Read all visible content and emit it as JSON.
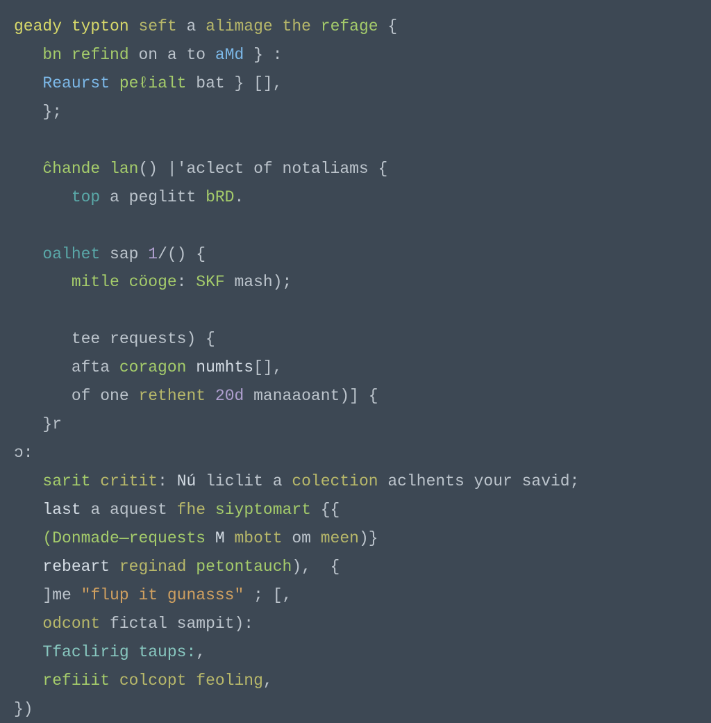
{
  "code": {
    "lines": [
      {
        "indent": 0,
        "tokens": [
          {
            "c": "t-yellow",
            "t": "geady typton"
          },
          {
            "c": "t-gray",
            "t": " "
          },
          {
            "c": "t-olive",
            "t": "seft"
          },
          {
            "c": "t-gray",
            "t": " a "
          },
          {
            "c": "t-olive",
            "t": "alimage"
          },
          {
            "c": "t-gray",
            "t": " "
          },
          {
            "c": "t-olive",
            "t": "the"
          },
          {
            "c": "t-gray",
            "t": " "
          },
          {
            "c": "t-green",
            "t": "refage"
          },
          {
            "c": "t-gray",
            "t": " {"
          }
        ]
      },
      {
        "indent": 1,
        "tokens": [
          {
            "c": "t-green",
            "t": "bn"
          },
          {
            "c": "t-gray",
            "t": " "
          },
          {
            "c": "t-green",
            "t": "refind"
          },
          {
            "c": "t-gray",
            "t": " on a to "
          },
          {
            "c": "t-blue",
            "t": "aMd"
          },
          {
            "c": "t-gray",
            "t": " } :"
          }
        ]
      },
      {
        "indent": 1,
        "tokens": [
          {
            "c": "t-blue",
            "t": "Reaurst"
          },
          {
            "c": "t-gray",
            "t": " "
          },
          {
            "c": "t-green",
            "t": "peℓialt"
          },
          {
            "c": "t-gray",
            "t": " bat } [],"
          }
        ]
      },
      {
        "indent": 1,
        "tokens": [
          {
            "c": "t-gray",
            "t": "};"
          }
        ]
      },
      {
        "indent": 0,
        "tokens": [
          {
            "c": "t-gray",
            "t": " "
          }
        ]
      },
      {
        "indent": 1,
        "tokens": [
          {
            "c": "t-green",
            "t": "ĉhande"
          },
          {
            "c": "t-gray",
            "t": " "
          },
          {
            "c": "t-green",
            "t": "lan"
          },
          {
            "c": "t-gray",
            "t": "() |'aclect of notaliams {"
          }
        ]
      },
      {
        "indent": 2,
        "tokens": [
          {
            "c": "t-teal",
            "t": "top"
          },
          {
            "c": "t-gray",
            "t": " a peglitt "
          },
          {
            "c": "t-green",
            "t": "bRD"
          },
          {
            "c": "t-gray",
            "t": "."
          }
        ]
      },
      {
        "indent": 0,
        "tokens": [
          {
            "c": "t-gray",
            "t": " "
          }
        ]
      },
      {
        "indent": 1,
        "tokens": [
          {
            "c": "t-teal",
            "t": "oalhet"
          },
          {
            "c": "t-gray",
            "t": " sap "
          },
          {
            "c": "t-lav",
            "t": "1"
          },
          {
            "c": "t-gray",
            "t": "/() {"
          }
        ]
      },
      {
        "indent": 2,
        "tokens": [
          {
            "c": "t-green",
            "t": "mitle"
          },
          {
            "c": "t-gray",
            "t": " "
          },
          {
            "c": "t-green",
            "t": "cöoge"
          },
          {
            "c": "t-gray",
            "t": ": "
          },
          {
            "c": "t-green",
            "t": "SKF"
          },
          {
            "c": "t-gray",
            "t": " mash);"
          }
        ]
      },
      {
        "indent": 0,
        "tokens": [
          {
            "c": "t-gray",
            "t": " "
          }
        ]
      },
      {
        "indent": 2,
        "tokens": [
          {
            "c": "t-gray",
            "t": "tee requests) {"
          }
        ]
      },
      {
        "indent": 2,
        "tokens": [
          {
            "c": "t-gray",
            "t": "afta "
          },
          {
            "c": "t-green",
            "t": "coragon"
          },
          {
            "c": "t-gray",
            "t": " "
          },
          {
            "c": "t-light",
            "t": "numhts"
          },
          {
            "c": "t-gray",
            "t": "[],"
          }
        ]
      },
      {
        "indent": 2,
        "tokens": [
          {
            "c": "t-gray",
            "t": "of one "
          },
          {
            "c": "t-olive",
            "t": "rethent"
          },
          {
            "c": "t-gray",
            "t": " "
          },
          {
            "c": "t-lav",
            "t": "20d"
          },
          {
            "c": "t-gray",
            "t": " manaaoant)] {"
          }
        ]
      },
      {
        "indent": 1,
        "tokens": [
          {
            "c": "t-gray",
            "t": "}r"
          }
        ]
      },
      {
        "indent": 0,
        "tokens": [
          {
            "c": "t-gray",
            "t": "ɔ:"
          }
        ]
      },
      {
        "indent": 1,
        "tokens": [
          {
            "c": "t-green",
            "t": "sarit"
          },
          {
            "c": "t-gray",
            "t": " "
          },
          {
            "c": "t-olive",
            "t": "critit"
          },
          {
            "c": "t-gray",
            "t": ": "
          },
          {
            "c": "t-light",
            "t": "Nú"
          },
          {
            "c": "t-gray",
            "t": " liclit a "
          },
          {
            "c": "t-olive",
            "t": "colection"
          },
          {
            "c": "t-gray",
            "t": " aclhents your savid;"
          }
        ]
      },
      {
        "indent": 1,
        "tokens": [
          {
            "c": "t-light",
            "t": "last"
          },
          {
            "c": "t-gray",
            "t": " a aquest "
          },
          {
            "c": "t-olive",
            "t": "fhe"
          },
          {
            "c": "t-gray",
            "t": " "
          },
          {
            "c": "t-green",
            "t": "siyptomart"
          },
          {
            "c": "t-gray",
            "t": " {{"
          }
        ]
      },
      {
        "indent": 1,
        "tokens": [
          {
            "c": "t-green",
            "t": "(Donmade—requests"
          },
          {
            "c": "t-gray",
            "t": " "
          },
          {
            "c": "t-light",
            "t": "M"
          },
          {
            "c": "t-gray",
            "t": " "
          },
          {
            "c": "t-olive",
            "t": "mbott"
          },
          {
            "c": "t-gray",
            "t": " om "
          },
          {
            "c": "t-olive",
            "t": "meen"
          },
          {
            "c": "t-gray",
            "t": ")}"
          }
        ]
      },
      {
        "indent": 1,
        "tokens": [
          {
            "c": "t-light",
            "t": "rebeart"
          },
          {
            "c": "t-gray",
            "t": " "
          },
          {
            "c": "t-olive",
            "t": "reginad"
          },
          {
            "c": "t-gray",
            "t": " "
          },
          {
            "c": "t-green",
            "t": "petontauch"
          },
          {
            "c": "t-gray",
            "t": "),  {"
          }
        ]
      },
      {
        "indent": 1,
        "tokens": [
          {
            "c": "t-gray",
            "t": "]me "
          },
          {
            "c": "t-orange",
            "t": "\"flup it gunasss\""
          },
          {
            "c": "t-gray",
            "t": " ; [,"
          }
        ]
      },
      {
        "indent": 1,
        "tokens": [
          {
            "c": "t-olive",
            "t": "odcont"
          },
          {
            "c": "t-gray",
            "t": " fictal sampit):"
          }
        ]
      },
      {
        "indent": 1,
        "tokens": [
          {
            "c": "t-cyan",
            "t": "Tfaclirig taups:"
          },
          {
            "c": "t-gray",
            "t": ","
          }
        ]
      },
      {
        "indent": 1,
        "tokens": [
          {
            "c": "t-green",
            "t": "refiiit"
          },
          {
            "c": "t-gray",
            "t": " "
          },
          {
            "c": "t-olive",
            "t": "colcopt"
          },
          {
            "c": "t-gray",
            "t": " "
          },
          {
            "c": "t-olive",
            "t": "feoling"
          },
          {
            "c": "t-gray",
            "t": ","
          }
        ]
      },
      {
        "indent": 0,
        "tokens": [
          {
            "c": "t-gray",
            "t": "})"
          }
        ]
      }
    ]
  },
  "indent_unit": "   "
}
